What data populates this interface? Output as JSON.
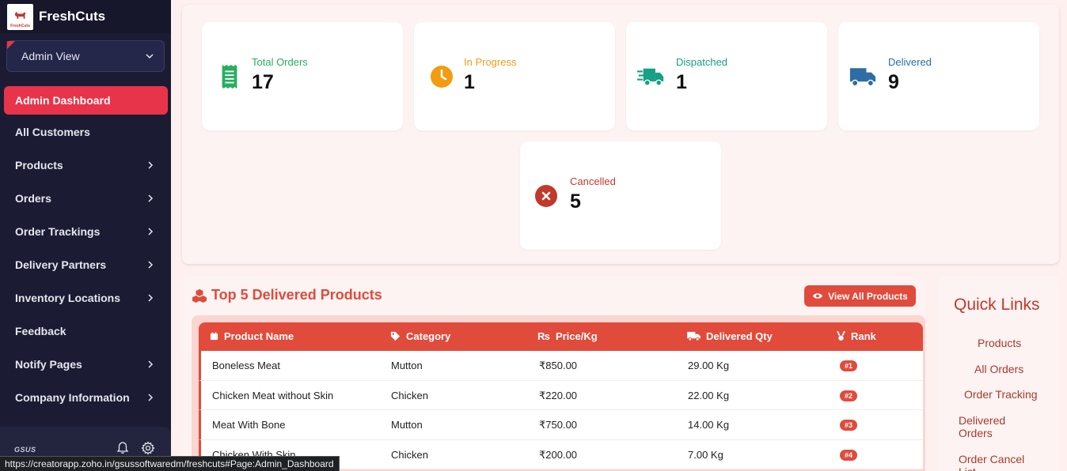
{
  "sidebar": {
    "brand_name": "FreshCuts",
    "logo_text": "FreshCuts",
    "view_select": "Admin View",
    "items": [
      {
        "label": "Admin Dashboard",
        "active": true,
        "has_arrow": false
      },
      {
        "label": "All Customers",
        "has_arrow": false
      },
      {
        "label": "Products",
        "has_arrow": true
      },
      {
        "label": "Orders",
        "has_arrow": true
      },
      {
        "label": "Order Trackings",
        "has_arrow": true
      },
      {
        "label": "Delivery Partners",
        "has_arrow": true
      },
      {
        "label": "Inventory Locations",
        "has_arrow": true
      },
      {
        "label": "Feedback",
        "has_arrow": false
      },
      {
        "label": "Notify Pages",
        "has_arrow": true
      },
      {
        "label": "Company Information",
        "has_arrow": true
      }
    ],
    "footer_logo": "GSUS"
  },
  "status_url": "https://creatorapp.zoho.in/gsussoftwaredm/freshcuts#Page:Admin_Dashboard",
  "stats": [
    {
      "label": "Total Orders",
      "value": "17",
      "color": "#27ae60",
      "icon": "receipt-icon"
    },
    {
      "label": "In Progress",
      "value": "1",
      "color": "#f39c12",
      "icon": "clock-icon"
    },
    {
      "label": "Dispatched",
      "value": "1",
      "color": "#16a085",
      "icon": "fast-truck-icon"
    },
    {
      "label": "Delivered",
      "value": "9",
      "color": "#2e6da4",
      "icon": "truck-icon"
    },
    {
      "label": "Cancelled",
      "value": "5",
      "color": "#c0392b",
      "icon": "cancel-icon"
    }
  ],
  "products": {
    "title": "Top 5 Delivered Products",
    "view_all_label": "View All Products",
    "columns": [
      "Product Name",
      "Category",
      "Price/Kg",
      "Delivered Qty",
      "Rank"
    ],
    "rows": [
      {
        "name": "Boneless Meat",
        "category": "Mutton",
        "price": "₹850.00",
        "qty": "29.00 Kg",
        "rank": "#1"
      },
      {
        "name": "Chicken Meat without Skin",
        "category": "Chicken",
        "price": "₹220.00",
        "qty": "22.00 Kg",
        "rank": "#2"
      },
      {
        "name": "Meat With Bone",
        "category": "Mutton",
        "price": "₹750.00",
        "qty": "14.00 Kg",
        "rank": "#3"
      },
      {
        "name": "Chicken With Skin",
        "category": "Chicken",
        "price": "₹200.00",
        "qty": "7.00 Kg",
        "rank": "#4"
      }
    ]
  },
  "quick_links": {
    "title": "Quick Links",
    "items": [
      "Products",
      "All Orders",
      "Order Tracking",
      "Delivered Orders",
      "Order Cancel List"
    ]
  },
  "colors": {
    "accent": "#e8344a",
    "table_header": "#e04b3c",
    "sidebar_bg": "#1b1c33"
  }
}
